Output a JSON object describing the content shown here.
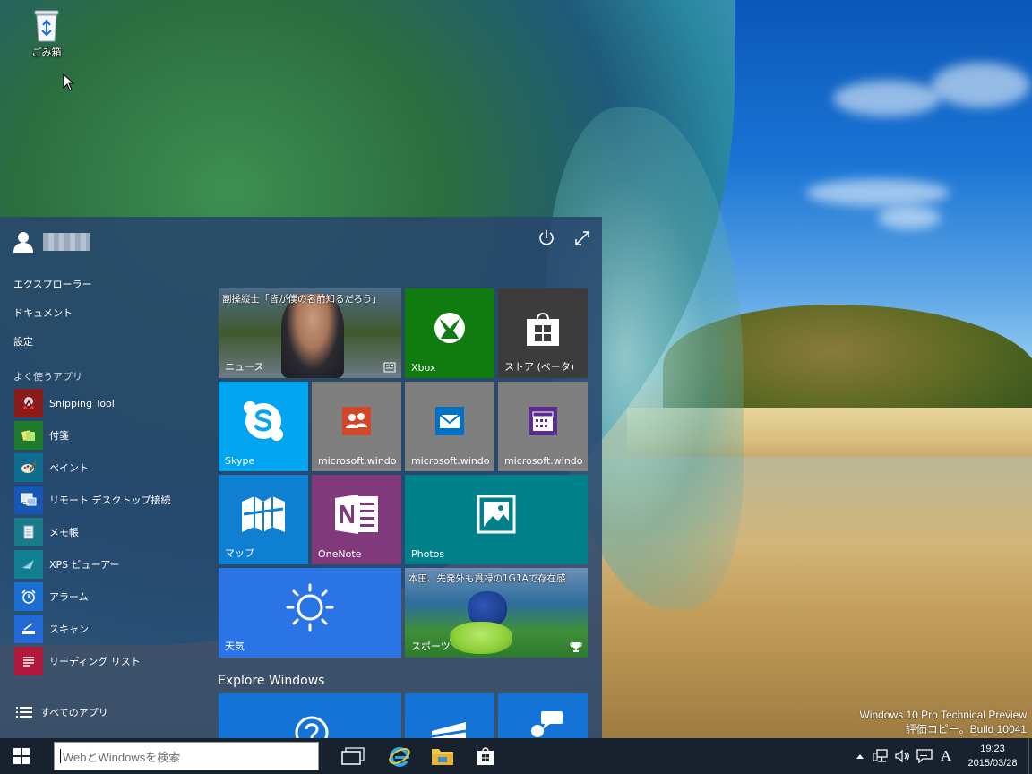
{
  "desktop": {
    "recycle_bin_label": "ごみ箱",
    "watermark": {
      "line1": "Windows 10 Pro Technical Preview",
      "line2": "評価コピー。Build 10041"
    }
  },
  "start_menu": {
    "places": [
      "エクスプローラー",
      "ドキュメント",
      "設定"
    ],
    "most_used_heading": "よく使うアプリ",
    "apps": [
      {
        "label": "Snipping Tool",
        "icon": "snipping-tool-icon",
        "color": "#8b1a1a"
      },
      {
        "label": "付箋",
        "icon": "sticky-notes-icon",
        "color": "#1e7b2c"
      },
      {
        "label": "ペイント",
        "icon": "paint-icon",
        "color": "#0f6d8f"
      },
      {
        "label": "リモート デスクトップ接続",
        "icon": "remote-desktop-icon",
        "color": "#1756b5"
      },
      {
        "label": "メモ帳",
        "icon": "notepad-icon",
        "color": "#1a7a8c"
      },
      {
        "label": "XPS ビューアー",
        "icon": "xps-viewer-icon",
        "color": "#137e92"
      },
      {
        "label": "アラーム",
        "icon": "alarm-icon",
        "color": "#1a6fd2"
      },
      {
        "label": "スキャン",
        "icon": "scan-icon",
        "color": "#2369d6"
      },
      {
        "label": "リーディング リスト",
        "icon": "reading-list-icon",
        "color": "#b0193b"
      }
    ],
    "all_apps_label": "すべてのアプリ",
    "tiles": {
      "news": {
        "headline": "副操縦士「皆が僕の名前知るだろう」",
        "label": "ニュース"
      },
      "xbox": {
        "label": "Xbox",
        "color": "#107c10"
      },
      "store": {
        "label": "ストア (ベータ)",
        "color": "#3c3c3c"
      },
      "skype": {
        "label": "Skype",
        "color": "#00a4ef"
      },
      "people": {
        "label": "microsoft.windo",
        "color": "#7f7f7f"
      },
      "mail": {
        "label": "microsoft.windo",
        "color": "#7f7f7f"
      },
      "calendar": {
        "label": "microsoft.windo",
        "color": "#7f7f7f"
      },
      "maps": {
        "label": "マップ",
        "color": "#0f7fd1"
      },
      "onenote": {
        "label": "OneNote",
        "color": "#80397b"
      },
      "photos": {
        "label": "Photos",
        "color": "#00808a"
      },
      "weather": {
        "label": "天気",
        "color": "#2b74e6"
      },
      "sports": {
        "headline": "本田、先発外も貫禄の1G1Aで存在感",
        "label": "スポーツ"
      }
    },
    "explore_heading": "Explore Windows"
  },
  "taskbar": {
    "search_placeholder": "WebとWindowsを検索",
    "ime_mode": "A",
    "clock_time": "19:23",
    "clock_date": "2015/03/28"
  }
}
